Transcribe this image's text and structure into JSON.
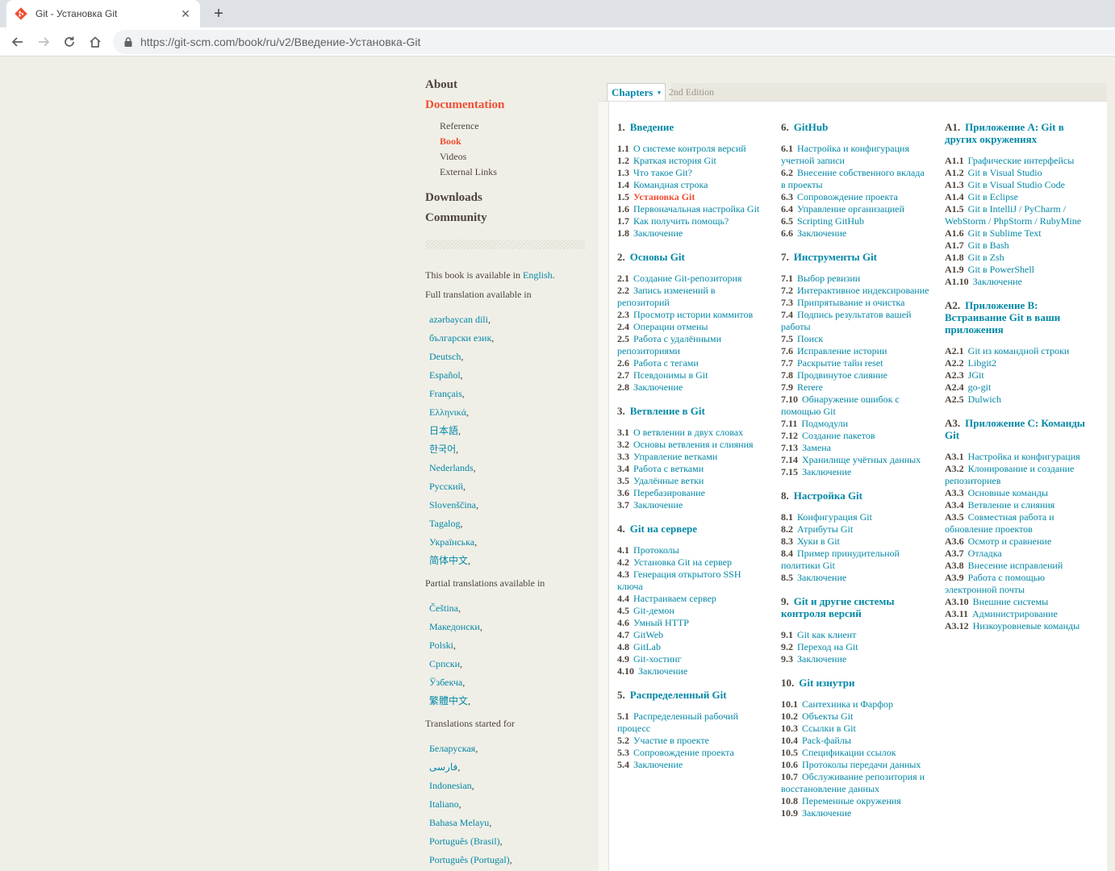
{
  "browser": {
    "tab_title": "Git - Установка Git",
    "new_tab": "+",
    "close": "✕",
    "url": "https://git-scm.com/book/ru/v2/Введение-Установка-Git",
    "accent": "#f14e32",
    "link_color": "#0388a6"
  },
  "sidebar": {
    "about": "About",
    "documentation": "Documentation",
    "subnav": [
      "Reference",
      "Book",
      "Videos",
      "External Links"
    ],
    "downloads": "Downloads",
    "community": "Community",
    "available_prefix": "This book is available in",
    "available_lang": "English",
    "available_suffix": ".",
    "full_label": "Full translation available in",
    "full_langs": [
      "azərbaycan dili",
      "български език",
      "Deutsch",
      "Español",
      "Français",
      "Ελληνικά",
      "日本語",
      "한국어",
      "Nederlands",
      "Русский",
      "Slovenščina",
      "Tagalog",
      "Українська",
      "简体中文"
    ],
    "partial_label": "Partial translations available in",
    "partial_langs": [
      "Čeština",
      "Македонски",
      "Polski",
      "Српски",
      "Ўзбекча",
      "繁體中文"
    ],
    "started_label": "Translations started for",
    "started_langs": [
      "Беларуская",
      "فارسی",
      "Indonesian",
      "Italiano",
      "Bahasa Melayu",
      "Português (Brasil)",
      "Português (Portugal)"
    ]
  },
  "toc": {
    "chapters_label": "Chapters",
    "caret": "▾",
    "edition": "2nd Edition",
    "columns": [
      [
        {
          "num": "1.",
          "title": "Введение",
          "sections": [
            {
              "n": "1.1",
              "t": "О системе контроля версий"
            },
            {
              "n": "1.2",
              "t": "Краткая история Git"
            },
            {
              "n": "1.3",
              "t": "Что такое Git?"
            },
            {
              "n": "1.4",
              "t": "Командная строка"
            },
            {
              "n": "1.5",
              "t": "Установка Git",
              "current": true
            },
            {
              "n": "1.6",
              "t": "Первоначальная настройка Git"
            },
            {
              "n": "1.7",
              "t": "Как получить помощь?"
            },
            {
              "n": "1.8",
              "t": "Заключение"
            }
          ]
        },
        {
          "num": "2.",
          "title": "Основы Git",
          "sections": [
            {
              "n": "2.1",
              "t": "Создание Git-репозитория"
            },
            {
              "n": "2.2",
              "t": "Запись изменений в репозиторий"
            },
            {
              "n": "2.3",
              "t": "Просмотр истории коммитов"
            },
            {
              "n": "2.4",
              "t": "Операции отмены"
            },
            {
              "n": "2.5",
              "t": "Работа с удалёнными репозиториями"
            },
            {
              "n": "2.6",
              "t": "Работа с тегами"
            },
            {
              "n": "2.7",
              "t": "Псевдонимы в Git"
            },
            {
              "n": "2.8",
              "t": "Заключение"
            }
          ]
        },
        {
          "num": "3.",
          "title": "Ветвление в Git",
          "sections": [
            {
              "n": "3.1",
              "t": "О ветвлении в двух словах"
            },
            {
              "n": "3.2",
              "t": "Основы ветвления и слияния"
            },
            {
              "n": "3.3",
              "t": "Управление ветками"
            },
            {
              "n": "3.4",
              "t": "Работа с ветками"
            },
            {
              "n": "3.5",
              "t": "Удалённые ветки"
            },
            {
              "n": "3.6",
              "t": "Перебазирование"
            },
            {
              "n": "3.7",
              "t": "Заключение"
            }
          ]
        },
        {
          "num": "4.",
          "title": "Git на сервере",
          "sections": [
            {
              "n": "4.1",
              "t": "Протоколы"
            },
            {
              "n": "4.2",
              "t": "Установка Git на сервер"
            },
            {
              "n": "4.3",
              "t": "Генерация открытого SSH ключа"
            },
            {
              "n": "4.4",
              "t": "Настраиваем сервер"
            },
            {
              "n": "4.5",
              "t": "Git-демон"
            },
            {
              "n": "4.6",
              "t": "Умный HTTP"
            },
            {
              "n": "4.7",
              "t": "GitWeb"
            },
            {
              "n": "4.8",
              "t": "GitLab"
            },
            {
              "n": "4.9",
              "t": "Git-хостинг"
            },
            {
              "n": "4.10",
              "t": "Заключение"
            }
          ]
        },
        {
          "num": "5.",
          "title": "Распределенный Git",
          "sections": [
            {
              "n": "5.1",
              "t": "Распределенный рабочий процесс"
            },
            {
              "n": "5.2",
              "t": "Участие в проекте"
            },
            {
              "n": "5.3",
              "t": "Сопровождение проекта"
            },
            {
              "n": "5.4",
              "t": "Заключение"
            }
          ]
        }
      ],
      [
        {
          "num": "6.",
          "title": "GitHub",
          "sections": [
            {
              "n": "6.1",
              "t": "Настройка и конфигурация учетной записи"
            },
            {
              "n": "6.2",
              "t": "Внесение собственного вклада в проекты"
            },
            {
              "n": "6.3",
              "t": "Сопровождение проекта"
            },
            {
              "n": "6.4",
              "t": "Управление организацией"
            },
            {
              "n": "6.5",
              "t": "Scripting GitHub"
            },
            {
              "n": "6.6",
              "t": "Заключение"
            }
          ]
        },
        {
          "num": "7.",
          "title": "Инструменты Git",
          "sections": [
            {
              "n": "7.1",
              "t": "Выбор ревизии"
            },
            {
              "n": "7.2",
              "t": "Интерактивное индексирование"
            },
            {
              "n": "7.3",
              "t": "Припрятывание и очистка"
            },
            {
              "n": "7.4",
              "t": "Подпись результатов вашей работы"
            },
            {
              "n": "7.5",
              "t": "Поиск"
            },
            {
              "n": "7.6",
              "t": "Исправление истории"
            },
            {
              "n": "7.7",
              "t": "Раскрытие тайн reset"
            },
            {
              "n": "7.8",
              "t": "Продвинутое слияние"
            },
            {
              "n": "7.9",
              "t": "Rerere"
            },
            {
              "n": "7.10",
              "t": "Обнаружение ошибок с помощью Git"
            },
            {
              "n": "7.11",
              "t": "Подмодули"
            },
            {
              "n": "7.12",
              "t": "Создание пакетов"
            },
            {
              "n": "7.13",
              "t": "Замена"
            },
            {
              "n": "7.14",
              "t": "Хранилище учётных данных"
            },
            {
              "n": "7.15",
              "t": "Заключение"
            }
          ]
        },
        {
          "num": "8.",
          "title": "Настройка Git",
          "sections": [
            {
              "n": "8.1",
              "t": "Конфигурация Git"
            },
            {
              "n": "8.2",
              "t": "Атрибуты Git"
            },
            {
              "n": "8.3",
              "t": "Хуки в Git"
            },
            {
              "n": "8.4",
              "t": "Пример принудительной политики Git"
            },
            {
              "n": "8.5",
              "t": "Заключение"
            }
          ]
        },
        {
          "num": "9.",
          "title": "Git и другие системы контроля версий",
          "sections": [
            {
              "n": "9.1",
              "t": "Git как клиент"
            },
            {
              "n": "9.2",
              "t": "Переход на Git"
            },
            {
              "n": "9.3",
              "t": "Заключение"
            }
          ]
        },
        {
          "num": "10.",
          "title": "Git изнутри",
          "sections": [
            {
              "n": "10.1",
              "t": "Сантехника и Фарфор"
            },
            {
              "n": "10.2",
              "t": "Объекты Git"
            },
            {
              "n": "10.3",
              "t": "Ссылки в Git"
            },
            {
              "n": "10.4",
              "t": "Pack-файлы"
            },
            {
              "n": "10.5",
              "t": "Спецификации ссылок"
            },
            {
              "n": "10.6",
              "t": "Протоколы передачи данных"
            },
            {
              "n": "10.7",
              "t": "Обслуживание репозитория и восстановление данных"
            },
            {
              "n": "10.8",
              "t": "Переменные окружения"
            },
            {
              "n": "10.9",
              "t": "Заключение"
            }
          ]
        }
      ],
      [
        {
          "num": "A1.",
          "title": "Приложение A: Git в других окружениях",
          "sections": [
            {
              "n": "A1.1",
              "t": "Графические интерфейсы"
            },
            {
              "n": "A1.2",
              "t": "Git в Visual Studio"
            },
            {
              "n": "A1.3",
              "t": "Git в Visual Studio Code"
            },
            {
              "n": "A1.4",
              "t": "Git в Eclipse"
            },
            {
              "n": "A1.5",
              "t": "Git в IntelliJ / PyCharm / WebStorm / PhpStorm / RubyMine"
            },
            {
              "n": "A1.6",
              "t": "Git в Sublime Text"
            },
            {
              "n": "A1.7",
              "t": "Git в Bash"
            },
            {
              "n": "A1.8",
              "t": "Git в Zsh"
            },
            {
              "n": "A1.9",
              "t": "Git в PowerShell"
            },
            {
              "n": "A1.10",
              "t": "Заключение"
            }
          ]
        },
        {
          "num": "A2.",
          "title": "Приложение B: Встраивание Git в ваши приложения",
          "sections": [
            {
              "n": "A2.1",
              "t": "Git из командной строки"
            },
            {
              "n": "A2.2",
              "t": "Libgit2"
            },
            {
              "n": "A2.3",
              "t": "JGit"
            },
            {
              "n": "A2.4",
              "t": "go-git"
            },
            {
              "n": "A2.5",
              "t": "Dulwich"
            }
          ]
        },
        {
          "num": "A3.",
          "title": "Приложение C: Команды Git",
          "sections": [
            {
              "n": "A3.1",
              "t": "Настройка и конфигурация"
            },
            {
              "n": "A3.2",
              "t": "Клонирование и создание репозиториев"
            },
            {
              "n": "A3.3",
              "t": "Основные команды"
            },
            {
              "n": "A3.4",
              "t": "Ветвление и слияния"
            },
            {
              "n": "A3.5",
              "t": "Совместная работа и обновление проектов"
            },
            {
              "n": "A3.6",
              "t": "Осмотр и сравнение"
            },
            {
              "n": "A3.7",
              "t": "Отладка"
            },
            {
              "n": "A3.8",
              "t": "Внесение исправлений"
            },
            {
              "n": "A3.9",
              "t": "Работа с помощью электронной почты"
            },
            {
              "n": "A3.10",
              "t": "Внешние системы"
            },
            {
              "n": "A3.11",
              "t": "Администрирование"
            },
            {
              "n": "A3.12",
              "t": "Низкоуровневые команды"
            }
          ]
        }
      ]
    ]
  }
}
